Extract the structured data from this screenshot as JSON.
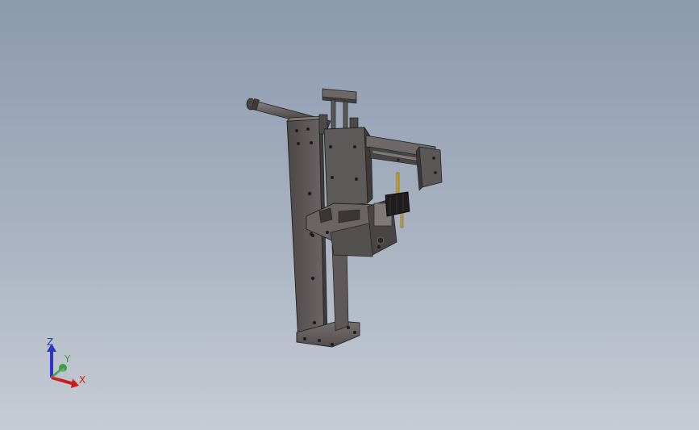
{
  "viewport": {
    "background_top": "#8c9aae",
    "background_bottom": "#c6ccd5",
    "model_color": "#5a5555",
    "model_edge_color": "#222222"
  },
  "triad": {
    "x_label": "X",
    "y_label": "Y",
    "z_label": "Z",
    "x_color": "#c81c1c",
    "y_color": "#3aa040",
    "z_color": "#2c35c8"
  }
}
